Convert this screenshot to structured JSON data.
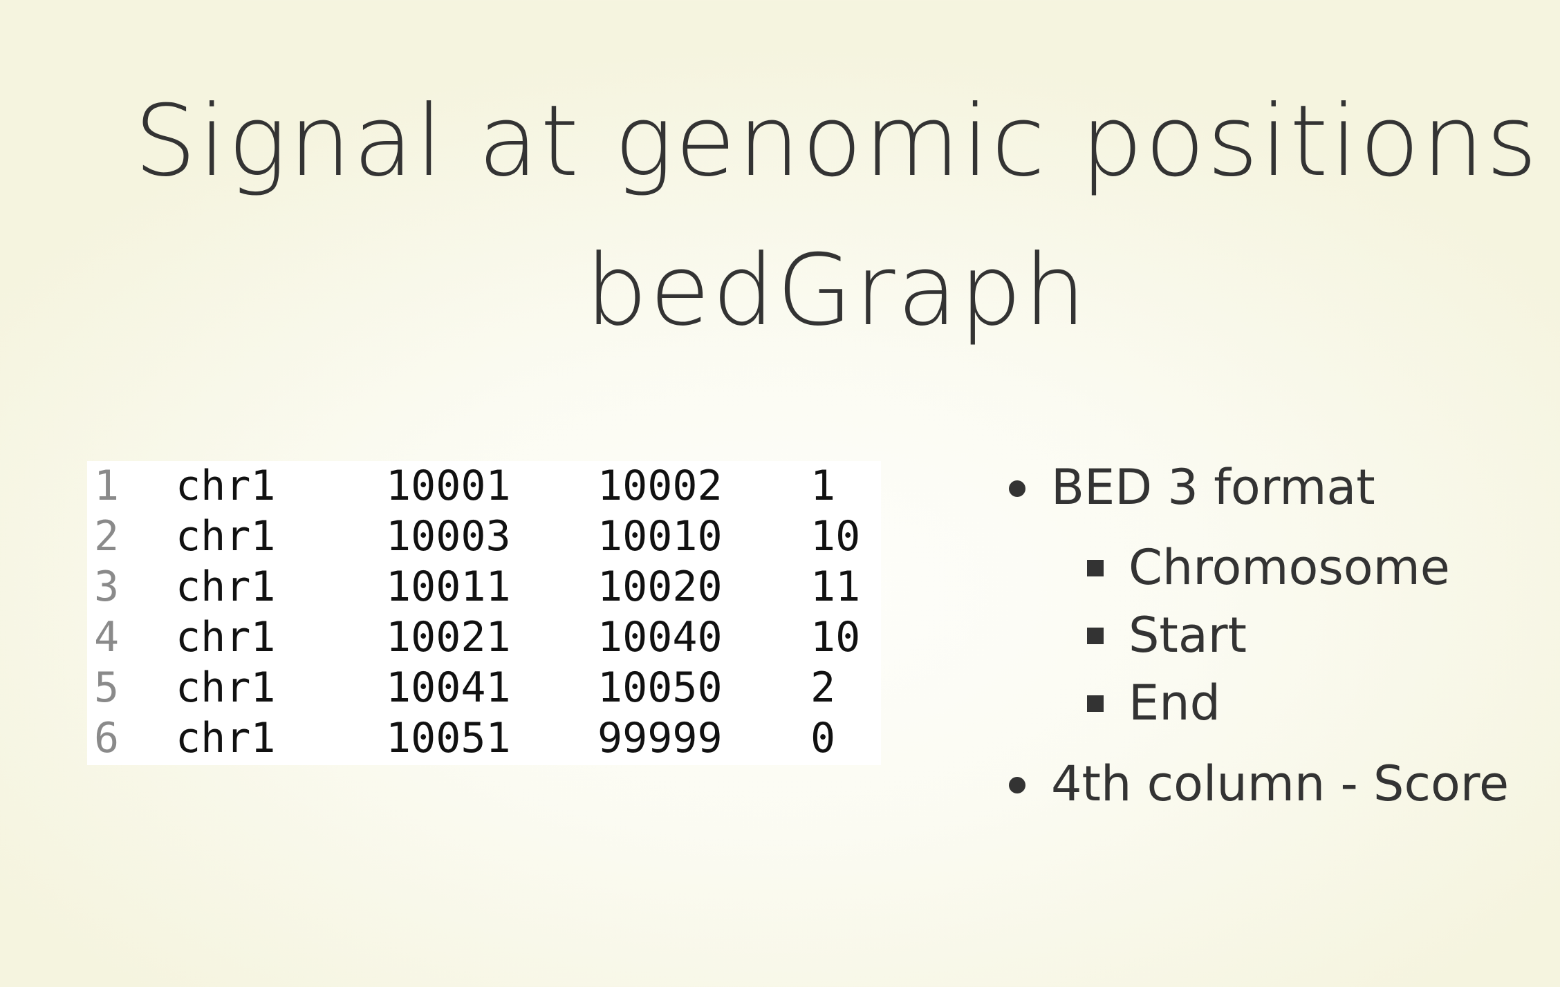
{
  "slide": {
    "title_line_1": "Signal at genomic positions",
    "title_line_2": "bedGraph"
  },
  "table": {
    "rows": [
      {
        "line": "1",
        "chrom": "chr1",
        "start": "10001",
        "end": "10002",
        "score": "1"
      },
      {
        "line": "2",
        "chrom": "chr1",
        "start": "10003",
        "end": "10010",
        "score": "10"
      },
      {
        "line": "3",
        "chrom": "chr1",
        "start": "10011",
        "end": "10020",
        "score": "11"
      },
      {
        "line": "4",
        "chrom": "chr1",
        "start": "10021",
        "end": "10040",
        "score": "10"
      },
      {
        "line": "5",
        "chrom": "chr1",
        "start": "10041",
        "end": "10050",
        "score": "2"
      },
      {
        "line": "6",
        "chrom": "chr1",
        "start": "10051",
        "end": "99999",
        "score": "0"
      }
    ]
  },
  "bullets": {
    "item_1": "BED 3 format",
    "sub_items": [
      "Chromosome",
      "Start",
      "End"
    ],
    "item_2": "4th column - Score"
  },
  "colors": {
    "text": "#333333",
    "background": "#fbfbf2",
    "code_background": "#ffffff",
    "line_number": "#8a8a8a"
  }
}
